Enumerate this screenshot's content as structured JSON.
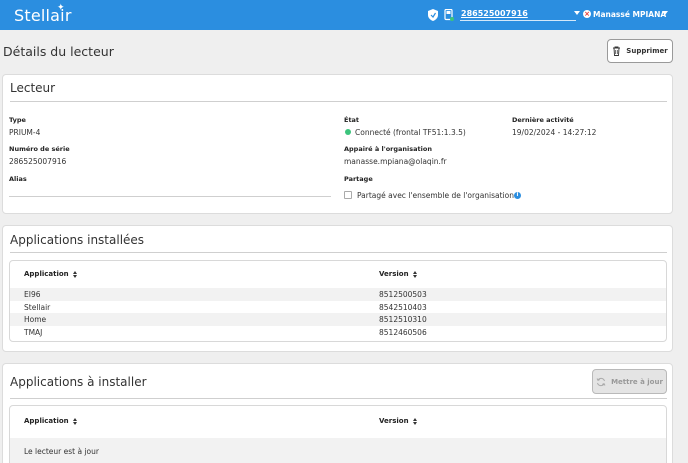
{
  "header": {
    "logo": "Stellair",
    "reader_serial": "286525007916",
    "user_name": "Manassé MPIANA",
    "colors": {
      "bar": "#2b8ee0",
      "status_ok": "#3cc47c",
      "user_badge": "#e53935"
    },
    "icons": [
      "shield-icon",
      "reader-device-icon",
      "chevron-down-icon",
      "close-circle-icon"
    ]
  },
  "page": {
    "title": "Détails du lecteur",
    "delete_label": "Supprimer"
  },
  "reader": {
    "section_title": "Lecteur",
    "type_label": "Type",
    "type_value": "PRIUM-4",
    "serial_label": "Numéro de série",
    "serial_value": "286525007916",
    "alias_label": "Alias",
    "state_label": "État",
    "state_value": "Connecté (frontal TF51:1.3.5)",
    "last_activity_label": "Dernière activité",
    "last_activity_value": "19/02/2024 - 14:27:12",
    "paired_label": "Appairé à l'organisation",
    "paired_value": "manasse.mpiana@olaqin.fr",
    "sharing_label": "Partage",
    "sharing_checkbox_label": "Partagé avec l'ensemble de l'organisation",
    "sharing_checked": false
  },
  "installed": {
    "section_title": "Applications installées",
    "col_app": "Application",
    "col_version": "Version",
    "rows": [
      {
        "app": "EI96",
        "version": "8512500503"
      },
      {
        "app": "Stellair",
        "version": "8542510403"
      },
      {
        "app": "Home",
        "version": "8512510310"
      },
      {
        "app": "TMAJ",
        "version": "8512460506"
      }
    ]
  },
  "to_install": {
    "section_title": "Applications à installer",
    "update_label": "Mettre à jour",
    "col_app": "Application",
    "col_version": "Version",
    "empty_message": "Le lecteur est à jour"
  }
}
